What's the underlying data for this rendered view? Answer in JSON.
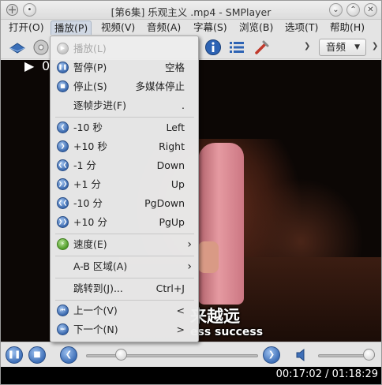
{
  "window": {
    "title": "[第6集] 乐观主义 .mp4 - SMPlayer"
  },
  "menubar": [
    {
      "label": "打开(O)",
      "active": false
    },
    {
      "label": "播放(P)",
      "active": true
    },
    {
      "label": "视频(V)",
      "active": false
    },
    {
      "label": "音频(A)",
      "active": false
    },
    {
      "label": "字幕(S)",
      "active": false
    },
    {
      "label": "浏览(B)",
      "active": false
    },
    {
      "label": "选项(T)",
      "active": false
    },
    {
      "label": "帮助(H)",
      "active": false
    }
  ],
  "toolbar": {
    "audio_select": "音频"
  },
  "play_menu": {
    "items": [
      {
        "label": "播放(L)",
        "shortcut": "",
        "icon": "play-icon",
        "disabled": true
      },
      {
        "label": "暂停(P)",
        "shortcut": "空格",
        "icon": "pause-icon"
      },
      {
        "label": "停止(S)",
        "shortcut": "多媒体停止",
        "icon": "stop-icon"
      },
      {
        "label": "逐帧步进(F)",
        "shortcut": ".",
        "icon": ""
      },
      {
        "label": "-10 秒",
        "shortcut": "Left",
        "icon": "rewind-icon"
      },
      {
        "label": "+10 秒",
        "shortcut": "Right",
        "icon": "forward-icon"
      },
      {
        "label": "-1 分",
        "shortcut": "Down",
        "icon": "rewind-fast-icon"
      },
      {
        "label": "+1 分",
        "shortcut": "Up",
        "icon": "forward-fast-icon"
      },
      {
        "label": "-10 分",
        "shortcut": "PgDown",
        "icon": "rewind-fastest-icon"
      },
      {
        "label": "+10 分",
        "shortcut": "PgUp",
        "icon": "forward-fastest-icon"
      },
      {
        "label": "速度(E)",
        "shortcut": "",
        "icon": "speed-icon"
      },
      {
        "label": "A-B 区域(A)",
        "shortcut": "",
        "icon": ""
      },
      {
        "label": "跳转到(J)...",
        "shortcut": "Ctrl+J",
        "icon": ""
      },
      {
        "label": "上一个(V)",
        "shortcut": "<",
        "icon": "previous-icon"
      },
      {
        "label": "下一个(N)",
        "shortcut": ">",
        "icon": "next-icon"
      }
    ],
    "submenu_arrow": "›"
  },
  "video": {
    "osd_text": "0",
    "subtitle_line1": "来越远",
    "subtitle_line2": "ess success"
  },
  "controls": {
    "seek_fraction": 0.18,
    "volume_fraction": 1.0
  },
  "status": {
    "time": "00:17:02 / 01:18:29"
  },
  "colors": {
    "accent_blue": "#3e6fb7",
    "menu_bg": "#ececec",
    "speed_green": "#4f9b27"
  }
}
